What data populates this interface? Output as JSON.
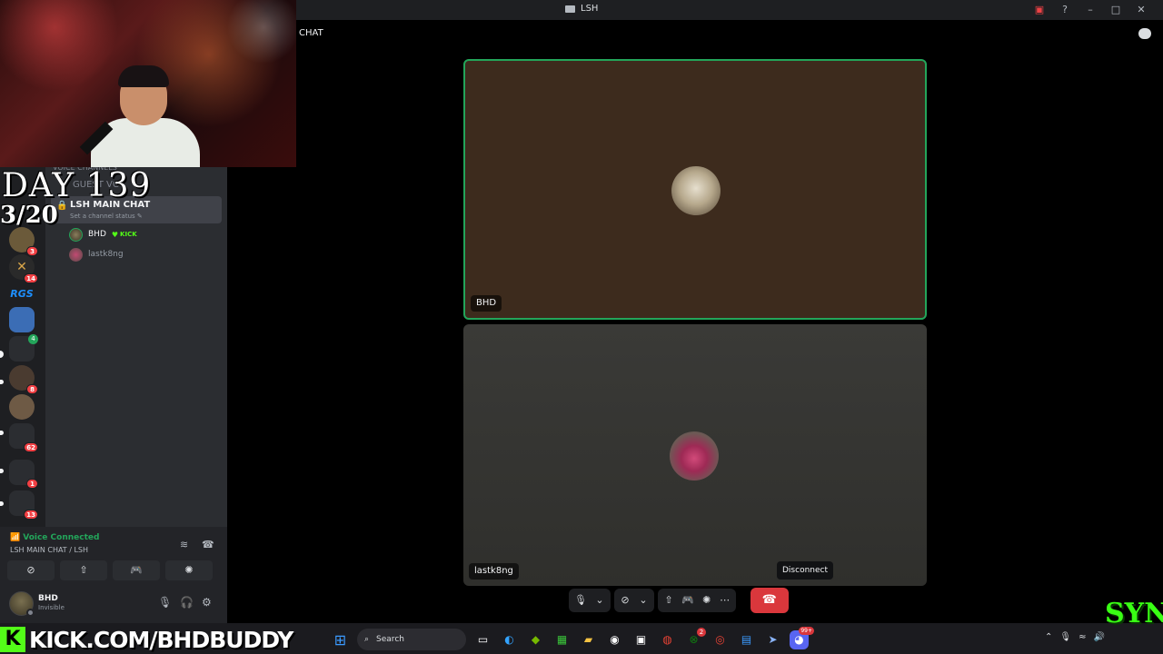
{
  "window": {
    "title": "LSH"
  },
  "overlay": {
    "day": "DAY 139",
    "date": "3/20",
    "kick_url": "KICK.COM/BHDBUDDY",
    "kick_logo": "K",
    "syn_logo": "SYN"
  },
  "sidebar": {
    "category": "Voice Channels",
    "ghost_channel": "GUEST VC",
    "active_channel": {
      "name": "LSH MAIN CHAT",
      "status_placeholder": "Set a channel status"
    },
    "voice_users": [
      {
        "name": "BHD",
        "badge": "KICK"
      },
      {
        "name": "lastk8ng"
      }
    ],
    "server_badges": [
      "3",
      "14",
      "4",
      "8",
      "62",
      "1",
      "13"
    ],
    "server_rgs": "RGS"
  },
  "voice_panel": {
    "status": "Voice Connected",
    "channel": "LSH MAIN CHAT / LSH"
  },
  "user_panel": {
    "username": "BHD",
    "status": "Invisible"
  },
  "main": {
    "chat_label": "CHAT",
    "tiles": [
      {
        "name": "BHD",
        "speaking": true
      },
      {
        "name": "lastk8ng",
        "speaking": false
      }
    ],
    "tooltip": "Disconnect"
  },
  "taskbar": {
    "search_label": "Search",
    "badges": {
      "xbox": "2",
      "discord": "99+"
    }
  },
  "colors": {
    "accent_green": "#23a55a",
    "hangup_red": "#da373c",
    "kick_green": "#53fc18"
  }
}
